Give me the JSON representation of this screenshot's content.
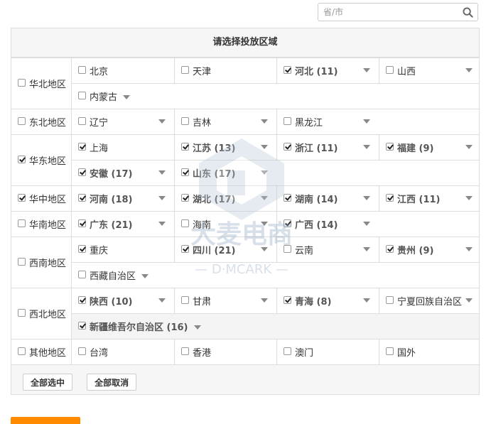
{
  "search": {
    "placeholder": "省/市"
  },
  "panel": {
    "title": "请选择投放区域"
  },
  "regions": [
    {
      "name": "华北地区",
      "checked": false,
      "rows": [
        [
          {
            "label": "北京",
            "checked": false,
            "arrow": false
          },
          {
            "label": "天津",
            "checked": false,
            "arrow": false
          },
          {
            "label": "河北 (11)",
            "checked": true,
            "arrow": true
          },
          {
            "label": "山西",
            "checked": false,
            "arrow": true
          }
        ],
        [
          {
            "label": "内蒙古",
            "checked": false,
            "arrow": true,
            "inline": true
          }
        ]
      ]
    },
    {
      "name": "东北地区",
      "checked": false,
      "rows": [
        [
          {
            "label": "辽宁",
            "checked": false,
            "arrow": true
          },
          {
            "label": "吉林",
            "checked": false,
            "arrow": true
          },
          {
            "label": "黑龙江",
            "checked": false,
            "arrow": true
          }
        ]
      ]
    },
    {
      "name": "华东地区",
      "checked": true,
      "rows": [
        [
          {
            "label": "上海",
            "checked": true,
            "arrow": false
          },
          {
            "label": "江苏 (13)",
            "checked": true,
            "arrow": true
          },
          {
            "label": "浙江 (11)",
            "checked": true,
            "arrow": true
          },
          {
            "label": "福建 (9)",
            "checked": true,
            "arrow": true
          }
        ],
        [
          {
            "label": "安徽 (17)",
            "checked": true,
            "arrow": true
          },
          {
            "label": "山东 (17)",
            "checked": true,
            "arrow": true
          }
        ]
      ]
    },
    {
      "name": "华中地区",
      "checked": true,
      "rows": [
        [
          {
            "label": "河南 (18)",
            "checked": true,
            "arrow": true
          },
          {
            "label": "湖北 (17)",
            "checked": true,
            "arrow": true
          },
          {
            "label": "湖南 (14)",
            "checked": true,
            "arrow": true
          },
          {
            "label": "江西 (11)",
            "checked": true,
            "arrow": true
          }
        ]
      ]
    },
    {
      "name": "华南地区",
      "checked": false,
      "rows": [
        [
          {
            "label": "广东 (21)",
            "checked": true,
            "arrow": true
          },
          {
            "label": "海南",
            "checked": false,
            "arrow": true
          },
          {
            "label": "广西 (14)",
            "checked": true,
            "arrow": true
          }
        ]
      ]
    },
    {
      "name": "西南地区",
      "checked": false,
      "rows": [
        [
          {
            "label": "重庆",
            "checked": true,
            "arrow": false
          },
          {
            "label": "四川 (21)",
            "checked": true,
            "arrow": true
          },
          {
            "label": "云南",
            "checked": false,
            "arrow": true
          },
          {
            "label": "贵州 (9)",
            "checked": true,
            "arrow": true
          }
        ],
        [
          {
            "label": "西藏自治区",
            "checked": false,
            "arrow": true,
            "inline": true
          }
        ]
      ]
    },
    {
      "name": "西北地区",
      "checked": false,
      "rows": [
        [
          {
            "label": "陕西 (10)",
            "checked": true,
            "arrow": true
          },
          {
            "label": "甘肃",
            "checked": false,
            "arrow": true
          },
          {
            "label": "青海 (8)",
            "checked": true,
            "arrow": true
          },
          {
            "label": "宁夏回族自治区",
            "checked": false,
            "arrow": true
          }
        ],
        [
          {
            "label": "新疆维吾尔自治区 (16)",
            "checked": true,
            "arrow": true,
            "inline": true,
            "grey": true
          }
        ]
      ]
    },
    {
      "name": "其他地区",
      "checked": false,
      "rows": [
        [
          {
            "label": "台湾",
            "checked": false,
            "arrow": false
          },
          {
            "label": "香港",
            "checked": false,
            "arrow": false
          },
          {
            "label": "澳门",
            "checked": false,
            "arrow": false
          },
          {
            "label": "国外",
            "checked": false,
            "arrow": false
          }
        ]
      ]
    }
  ],
  "buttons": {
    "select_all": "全部选中",
    "deselect_all": "全部取消"
  },
  "watermark": {
    "text_cn": "大麦电商",
    "text_en": "— D·MCARK —",
    "color": "#8fa6c2"
  },
  "colors": {
    "accent": "#ff8a00"
  }
}
